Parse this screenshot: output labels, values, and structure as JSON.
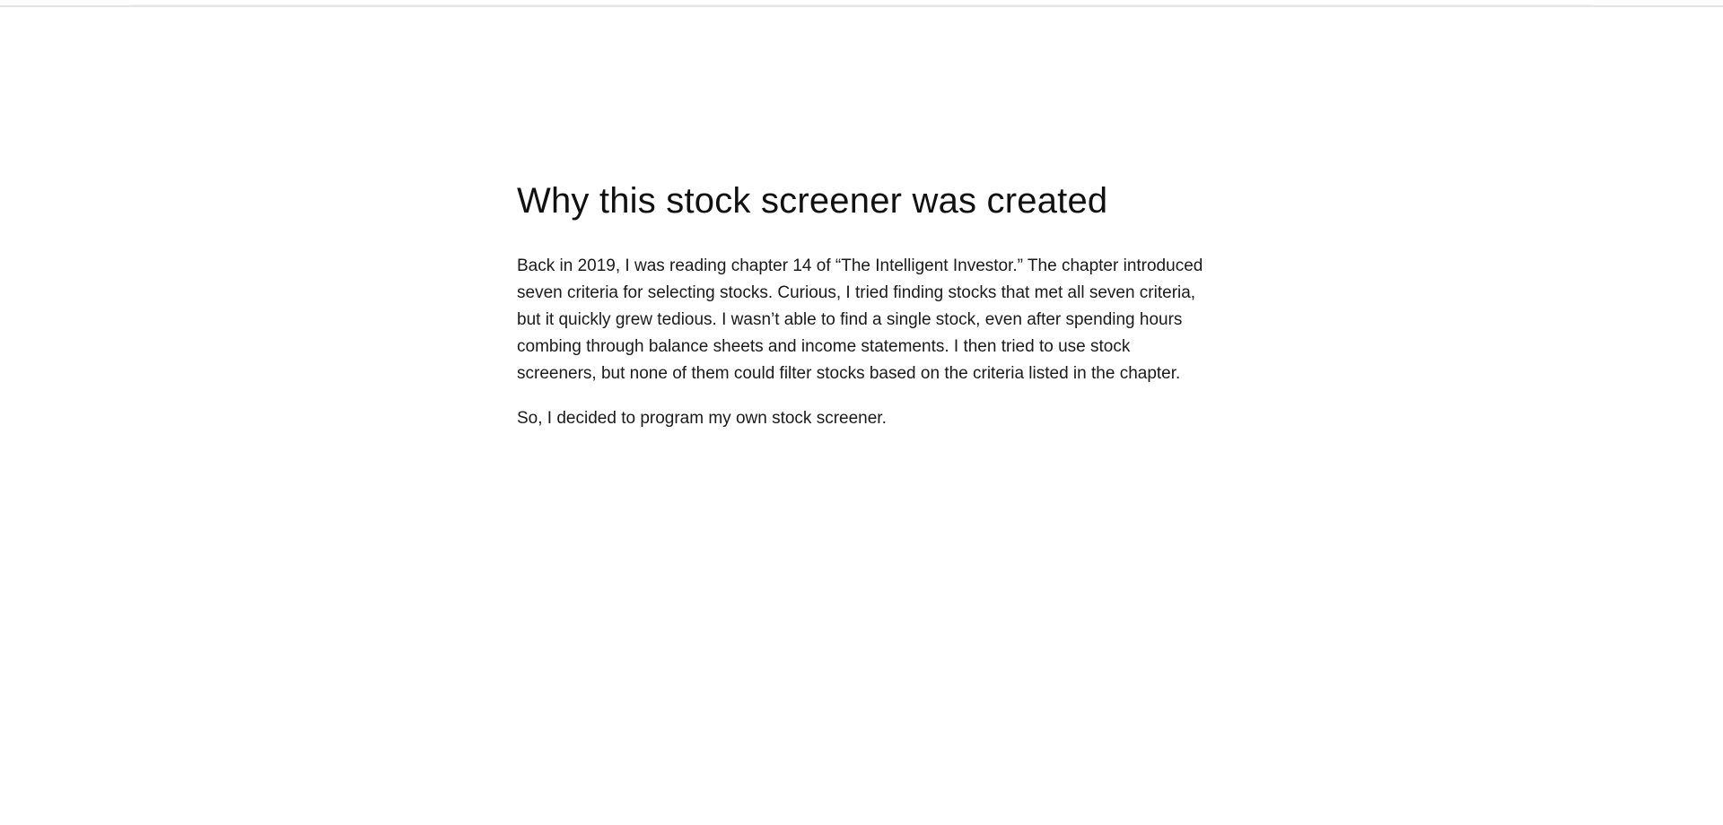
{
  "article": {
    "title": "Why this stock screener was created",
    "paragraphs": [
      "Back in 2019, I was reading chapter 14 of “The Intelligent Investor.” The chapter introduced seven criteria for selecting stocks. Curious, I tried finding stocks that met all seven criteria, but it quickly grew tedious. I wasn’t able to find a single stock, even after spending hours combing through balance sheets and income statements. I then tried to use stock screeners, but none of them could filter stocks based on the criteria listed in the chapter.",
      "So, I decided to program my own stock screener."
    ]
  }
}
